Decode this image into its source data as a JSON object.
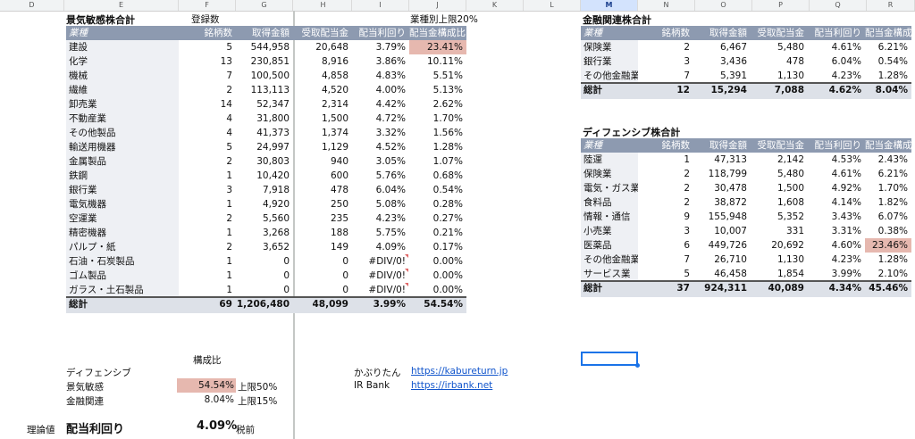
{
  "column_headers": [
    "D",
    "E",
    "F",
    "G",
    "H",
    "I",
    "J",
    "K",
    "L",
    "M",
    "N",
    "O",
    "P",
    "Q",
    "R"
  ],
  "selected_column": "M",
  "left_table": {
    "title": "景気敏感株合計",
    "registered_label": "登録数",
    "upper_limit_label": "業種別上限20%",
    "headers": [
      "業種",
      "銘柄数",
      "取得金額",
      "受取配当金",
      "配当利回り",
      "配当金構成比"
    ],
    "rows": [
      [
        "建設",
        "5",
        "544,958",
        "20,648",
        "3.79%",
        "23.41%"
      ],
      [
        "化学",
        "13",
        "230,851",
        "8,916",
        "3.86%",
        "10.11%"
      ],
      [
        "機械",
        "7",
        "100,500",
        "4,858",
        "4.83%",
        "5.51%"
      ],
      [
        "繊維",
        "2",
        "113,113",
        "4,520",
        "4.00%",
        "5.13%"
      ],
      [
        "卸売業",
        "14",
        "52,347",
        "2,314",
        "4.42%",
        "2.62%"
      ],
      [
        "不動産業",
        "4",
        "31,800",
        "1,500",
        "4.72%",
        "1.70%"
      ],
      [
        "その他製品",
        "4",
        "41,373",
        "1,374",
        "3.32%",
        "1.56%"
      ],
      [
        "輸送用機器",
        "5",
        "24,997",
        "1,129",
        "4.52%",
        "1.28%"
      ],
      [
        "金属製品",
        "2",
        "30,803",
        "940",
        "3.05%",
        "1.07%"
      ],
      [
        "鉄鋼",
        "1",
        "10,420",
        "600",
        "5.76%",
        "0.68%"
      ],
      [
        "銀行業",
        "3",
        "7,918",
        "478",
        "6.04%",
        "0.54%"
      ],
      [
        "電気機器",
        "1",
        "4,920",
        "250",
        "5.08%",
        "0.28%"
      ],
      [
        "空運業",
        "2",
        "5,560",
        "235",
        "4.23%",
        "0.27%"
      ],
      [
        "精密機器",
        "1",
        "3,268",
        "188",
        "5.75%",
        "0.21%"
      ],
      [
        "パルプ・紙",
        "2",
        "3,652",
        "149",
        "4.09%",
        "0.17%"
      ],
      [
        "石油・石炭製品",
        "1",
        "0",
        "0",
        "#DIV/0!",
        "0.00%"
      ],
      [
        "ゴム製品",
        "1",
        "0",
        "0",
        "#DIV/0!",
        "0.00%"
      ],
      [
        "ガラス・土石製品",
        "1",
        "0",
        "0",
        "#DIV/0!",
        "0.00%"
      ]
    ],
    "total": [
      "総計",
      "69",
      "1,206,480",
      "48,099",
      "3.99%",
      "54.54%"
    ]
  },
  "fin_table": {
    "title": "金融関連株合計",
    "headers": [
      "業種",
      "銘柄数",
      "取得金額",
      "受取配当金",
      "配当利回り",
      "配当金構成比"
    ],
    "rows": [
      [
        "保険業",
        "2",
        "6,467",
        "5,480",
        "4.61%",
        "6.21%"
      ],
      [
        "銀行業",
        "3",
        "3,436",
        "478",
        "6.04%",
        "0.54%"
      ],
      [
        "その他金融業",
        "7",
        "5,391",
        "1,130",
        "4.23%",
        "1.28%"
      ]
    ],
    "total": [
      "総計",
      "12",
      "15,294",
      "7,088",
      "4.62%",
      "8.04%"
    ]
  },
  "def_table": {
    "title": "ディフェンシブ株合計",
    "headers": [
      "業種",
      "銘柄数",
      "取得金額",
      "受取配当金",
      "配当利回り",
      "配当金構成比"
    ],
    "rows": [
      [
        "陸運",
        "1",
        "47,313",
        "2,142",
        "4.53%",
        "2.43%"
      ],
      [
        "保険業",
        "2",
        "118,799",
        "5,480",
        "4.61%",
        "6.21%"
      ],
      [
        "電気・ガス業",
        "2",
        "30,478",
        "1,500",
        "4.92%",
        "1.70%"
      ],
      [
        "食料品",
        "2",
        "38,872",
        "1,608",
        "4.14%",
        "1.82%"
      ],
      [
        "情報・通信",
        "9",
        "155,948",
        "5,352",
        "3.43%",
        "6.07%"
      ],
      [
        "小売業",
        "3",
        "10,007",
        "331",
        "3.31%",
        "0.38%"
      ],
      [
        "医薬品",
        "6",
        "449,726",
        "20,692",
        "4.60%",
        "23.46%"
      ],
      [
        "その他金融業",
        "7",
        "26,710",
        "1,130",
        "4.23%",
        "1.28%"
      ],
      [
        "サービス業",
        "5",
        "46,458",
        "1,854",
        "3.99%",
        "2.10%"
      ]
    ],
    "total": [
      "総計",
      "37",
      "924,311",
      "40,089",
      "4.34%",
      "45.46%"
    ]
  },
  "composition": {
    "title": "構成比",
    "rows": [
      {
        "label": "ディフェンシブ",
        "value": "",
        "note": ""
      },
      {
        "label": "景気敏感",
        "value": "54.54%",
        "note": "上限50%"
      },
      {
        "label": "金融関連",
        "value": "8.04%",
        "note": "上限15%"
      }
    ]
  },
  "theory": {
    "label": "理論値",
    "title": "配当利回り",
    "value": "4.09%",
    "note": "税前"
  },
  "links": [
    {
      "name": "かぶりたん",
      "url": "https://kabureturn.jp"
    },
    {
      "name": "IR Bank",
      "url": "https://irbank.net"
    }
  ],
  "colors": {
    "header_bg": "#8d9ab0",
    "highlight": "#e6b8af",
    "total_bg": "#dde1e8",
    "link": "#1155cc"
  }
}
